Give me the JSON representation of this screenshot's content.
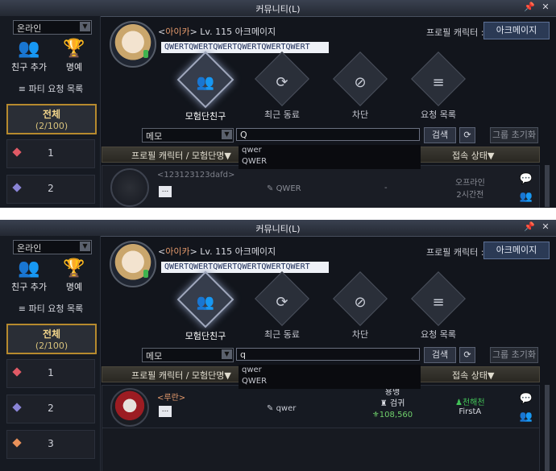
{
  "window": {
    "title": "커뮤니티(L)",
    "pin_glyph": "📌",
    "close_glyph": "✕"
  },
  "sidebar": {
    "status_value": "온라인",
    "add_friend_label": "친구 추가",
    "honor_label": "명예",
    "party_requests_label": "≡ 파티 요청 목록",
    "all_label": "전체",
    "all_count": "(2/100)",
    "groups": [
      {
        "num": "1",
        "color": "#e05a66"
      },
      {
        "num": "2",
        "color": "#8a84d6"
      },
      {
        "num": "3",
        "color": "#e9915a"
      }
    ]
  },
  "profile": {
    "prefix": "<",
    "name": "아이카",
    "suffix": "> Lv. 115 아크메이지",
    "message": "QWERTQWERTQWERTQWERTQWERTQWERT",
    "profile_character_label": "프로필 캐릭터 :",
    "profile_character_value": "아크메이지"
  },
  "tabs": [
    {
      "label": "모험단친구",
      "icon": "group-icon"
    },
    {
      "label": "최근 동료",
      "icon": "recent-icon"
    },
    {
      "label": "차단",
      "icon": "block-icon"
    },
    {
      "label": "요청 목록",
      "icon": "request-icon"
    }
  ],
  "search": {
    "filter_value": "메모",
    "top_query": "Q",
    "bottom_query": "q",
    "search_label": "검색",
    "reset_label": "그룹 초기화",
    "suggestions": [
      "qwer",
      "QWER"
    ]
  },
  "list_header": {
    "col1": "프로필 캐릭터 / 모험단명▼",
    "col2": "접속 상태▼"
  },
  "top_friend": {
    "name": "<123123123dafd>",
    "memo": "QWER",
    "guild": "-",
    "status_line1": "오프라인",
    "status_line2": "2시간전"
  },
  "bottom_friend": {
    "name": "<루란>",
    "memo": "qwer",
    "job": "용맹",
    "class": "검귀",
    "power": "108,560",
    "status_line1": "천해천",
    "status_line2": "FirstA"
  }
}
